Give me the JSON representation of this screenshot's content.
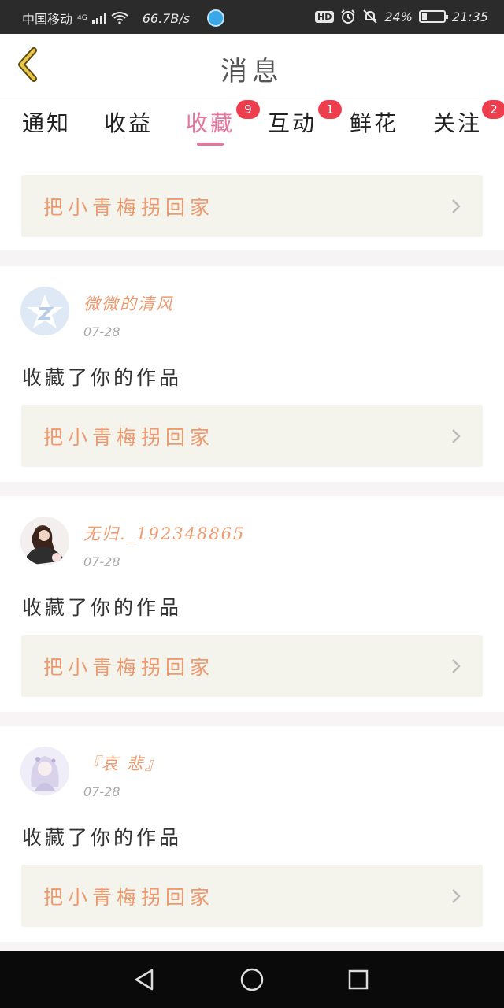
{
  "status_bar": {
    "carrier": "中国移动",
    "network": "4G",
    "speed": "66.7B/s",
    "battery": "24%",
    "battery_level": 0.24,
    "time": "21:35",
    "hd": "HD"
  },
  "header": {
    "title": "消息"
  },
  "tabs": [
    {
      "label": "通知",
      "badge": ""
    },
    {
      "label": "收益",
      "badge": ""
    },
    {
      "label": "收藏",
      "badge": "9",
      "active": true
    },
    {
      "label": "互动",
      "badge": "1"
    },
    {
      "label": "鲜花",
      "badge": ""
    },
    {
      "label": "关注",
      "badge": "2"
    }
  ],
  "items": [
    {
      "work": "把小青梅拐回家"
    },
    {
      "user": "微微的清风",
      "date": "07-28",
      "action": "收藏了你的作品",
      "work": "把小青梅拐回家"
    },
    {
      "user": "无归._192348865",
      "date": "07-28",
      "action": "收藏了你的作品",
      "work": "把小青梅拐回家"
    },
    {
      "user": "『哀 悲』",
      "date": "07-28",
      "action": "收藏了你的作品",
      "work": "把小青梅拐回家"
    }
  ],
  "colors": {
    "accent_pink": "#e5759a",
    "accent_orange": "#ee9a6e",
    "badge_red": "#ee3e4e"
  }
}
